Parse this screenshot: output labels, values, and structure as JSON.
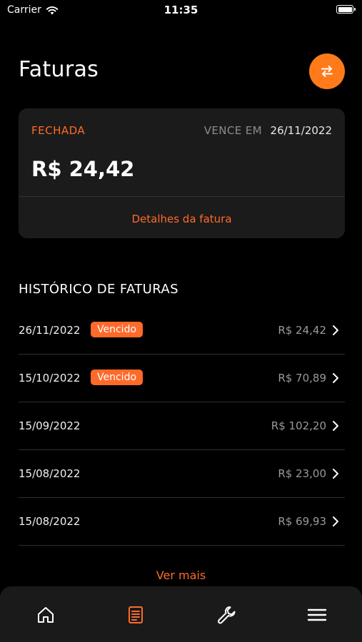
{
  "status_bar": {
    "carrier": "Carrier",
    "time": "11:35"
  },
  "header": {
    "title": "Faturas"
  },
  "invoice_card": {
    "status": "FECHADA",
    "due_label": "VENCE EM",
    "due_date": "26/11/2022",
    "amount": "R$ 24,42",
    "details_link": "Detalhes da fatura"
  },
  "history": {
    "title": "HISTÓRICO DE FATURAS",
    "items": [
      {
        "date": "26/11/2022",
        "badge": "Vencido",
        "value": "R$ 24,42"
      },
      {
        "date": "15/10/2022",
        "badge": "Vencido",
        "value": "R$ 70,89"
      },
      {
        "date": "15/09/2022",
        "badge": "",
        "value": "R$ 102,20"
      },
      {
        "date": "15/08/2022",
        "badge": "",
        "value": "R$ 23,00"
      },
      {
        "date": "15/08/2022",
        "badge": "",
        "value": "R$ 69,93"
      }
    ],
    "more_link": "Ver mais"
  },
  "tabs": [
    {
      "icon": "home-icon",
      "active": false
    },
    {
      "icon": "document-icon",
      "active": true
    },
    {
      "icon": "wrench-icon",
      "active": false
    },
    {
      "icon": "menu-icon",
      "active": false
    }
  ],
  "colors": {
    "accent": "#ff6a2a",
    "button": "#ff7a1a",
    "background": "#000000",
    "card": "#1b1b1b"
  }
}
